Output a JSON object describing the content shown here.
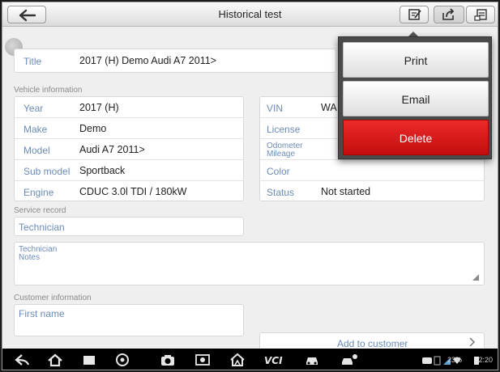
{
  "header": {
    "title": "Historical test",
    "back_icon": "back-arrow-icon",
    "edit_icon": "edit-note-icon",
    "share_icon": "share-icon",
    "report_icon": "report-icon"
  },
  "title_field": {
    "label": "Title",
    "value": "2017 (H) Demo Audi A7 2011>"
  },
  "vehicle_info": {
    "section_label": "Vehicle information",
    "left": [
      {
        "label": "Year",
        "value": "2017 (H)"
      },
      {
        "label": "Make",
        "value": "Demo"
      },
      {
        "label": "Model",
        "value": "Audi A7 2011>"
      },
      {
        "label": "Sub model",
        "value": "Sportback"
      },
      {
        "label": "Engine",
        "value": "CDUC 3.0l TDI / 180kW"
      }
    ],
    "right": [
      {
        "label": "VIN",
        "value": "WA"
      },
      {
        "label": "License",
        "value": ""
      },
      {
        "label": "Odometer Mileage",
        "value": ""
      },
      {
        "label": "Color",
        "value": ""
      },
      {
        "label": "Status",
        "value": "Not started"
      }
    ]
  },
  "service_record": {
    "section_label": "Service record",
    "technician_placeholder": "Technician",
    "notes_label": "Technician Notes"
  },
  "customer_info": {
    "section_label": "Customer information",
    "first_name_placeholder": "First name",
    "add_label": "Add to customer"
  },
  "share_menu": {
    "print": "Print",
    "email": "Email",
    "delete": "Delete"
  },
  "status_bar": {
    "battery": "23%",
    "time": "2:20"
  },
  "colors": {
    "label_blue": "#6b8bb8",
    "delete_red": "#d91a1a",
    "menu_bg": "#4a4a4a"
  }
}
